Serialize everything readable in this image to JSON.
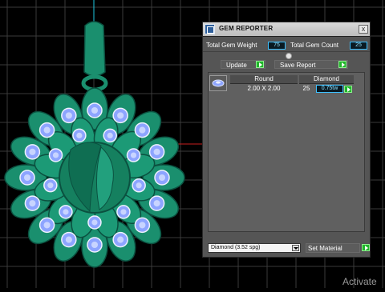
{
  "window": {
    "title": "GEM REPORTER",
    "close_label": "x"
  },
  "summary": {
    "weight_label": "Total Gem Weight",
    "weight_value": "75",
    "count_label": "Total Gem Count",
    "count_value": "25"
  },
  "actions": {
    "update_label": "Update",
    "save_report_label": "Save Report"
  },
  "table": {
    "col_shape": "Round",
    "col_material": "Diamond",
    "rows": [
      {
        "size": "2.00 X 2.00",
        "count": "25",
        "weight": "0.75tw"
      }
    ]
  },
  "material": {
    "selected": "Diamond   (3.52 spg)",
    "set_label": "Set Material"
  },
  "os": {
    "watermark": "Activate"
  },
  "colors": {
    "accent_value": "#8fe1ff",
    "button_green": "#21b52b",
    "model_green": "#1a8f6e",
    "gem_blue": "#8da4ff"
  }
}
